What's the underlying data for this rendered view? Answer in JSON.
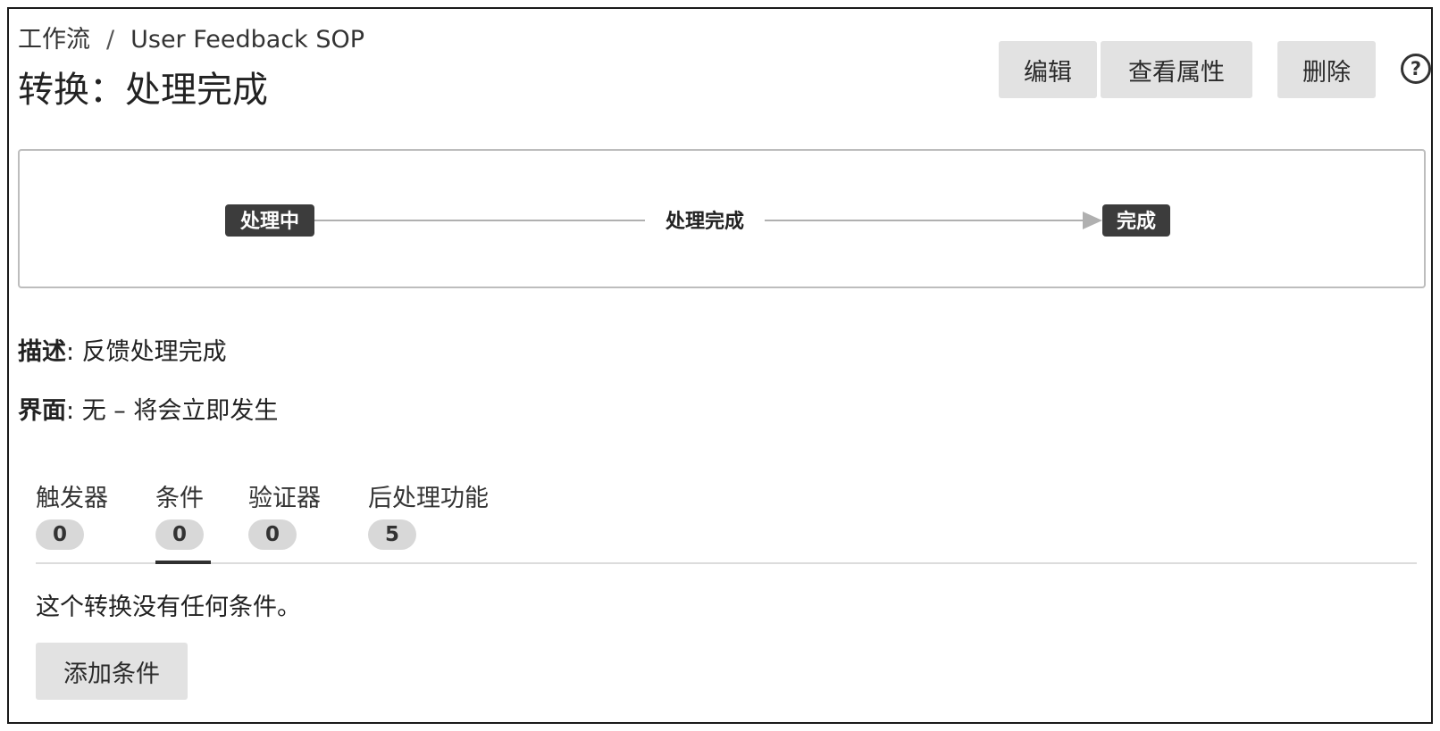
{
  "breadcrumb": {
    "root": "工作流",
    "separator": "/",
    "current": "User Feedback SOP"
  },
  "title": "转换：处理完成",
  "actions": {
    "edit": "编辑",
    "view_properties": "查看属性",
    "delete": "删除"
  },
  "help_icon": "help-circle-icon",
  "diagram": {
    "from_status": "处理中",
    "transition": "处理完成",
    "to_status": "完成"
  },
  "fields": {
    "description_label": "描述",
    "description_value": "反馈处理完成",
    "screen_label": "界面",
    "screen_value": "无 – 将会立即发生"
  },
  "tabs": [
    {
      "label": "触发器",
      "count": "0"
    },
    {
      "label": "条件",
      "count": "0",
      "active": true
    },
    {
      "label": "验证器",
      "count": "0"
    },
    {
      "label": "后处理功能",
      "count": "5"
    }
  ],
  "empty_message": "这个转换没有任何条件。",
  "add_button": "添加条件"
}
